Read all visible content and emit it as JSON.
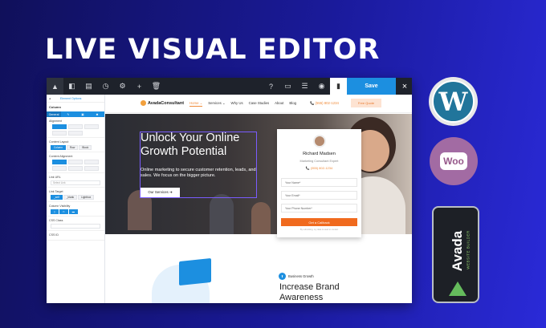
{
  "headline": "LIVE VISUAL EDITOR",
  "editor": {
    "toolbar": {
      "save_label": "Save",
      "close_label": "×",
      "icons": [
        "avada-logo-icon",
        "sidebar-toggle-icon",
        "library-icon",
        "history-icon",
        "settings-icon",
        "add-icon",
        "trash-icon",
        "help-icon",
        "desktop-preview-icon",
        "layers-icon",
        "eye-icon",
        "page-icon",
        "post-icon"
      ]
    },
    "panel": {
      "header_left": "Element Options",
      "title": "Column",
      "tabs": [
        "General",
        "Design",
        "Background",
        "Extras"
      ],
      "alignment_label": "Alignment",
      "content_layout_label": "Content Layout",
      "content_layout_options": [
        "Column",
        "Row",
        "Block"
      ],
      "content_alignment_label": "Content Alignment",
      "link_url_label": "Link URL",
      "link_url_placeholder": "Select Link",
      "link_target_label": "Link Target",
      "link_target_options": [
        "_self",
        "_blank",
        "Lightbox"
      ],
      "column_visibility_label": "Column Visibility",
      "css_class_label": "CSS Class",
      "css_id_label": "CSS ID"
    }
  },
  "site": {
    "brand": "AvadaConsultant",
    "menu": [
      {
        "label": "Home ⌄",
        "current": true
      },
      {
        "label": "Services ⌄",
        "current": false
      },
      {
        "label": "Why Us",
        "current": false
      },
      {
        "label": "Case Studies",
        "current": false
      },
      {
        "label": "About",
        "current": false
      },
      {
        "label": "Blog",
        "current": false
      }
    ],
    "phone": "📞 (555) 802-1234",
    "quote_btn": "Free Quote",
    "hero": {
      "title": "Unlock Your Online Growth Potential",
      "subtitle": "Online marketing to secure customer retention, leads, and sales. We focus on the bigger picture.",
      "button": "Our Services ➜"
    },
    "card": {
      "name": "Richard Madsen",
      "role": "Marketing Consultant Expert",
      "phone": "📞 (555) 802-1234",
      "fields": [
        "Your Name*",
        "Your Email*",
        "Your Phone Number*"
      ],
      "cta": "Get a Callback",
      "fine": "By submitting, my data is used to contact"
    },
    "section": {
      "badge_label": "Business Growth",
      "heading": "Increase Brand Awareness"
    }
  },
  "badges": {
    "wordpress": "W",
    "woo": "Woo",
    "avada": "Avada",
    "avada_sub": "WEBSITE BUILDER"
  }
}
